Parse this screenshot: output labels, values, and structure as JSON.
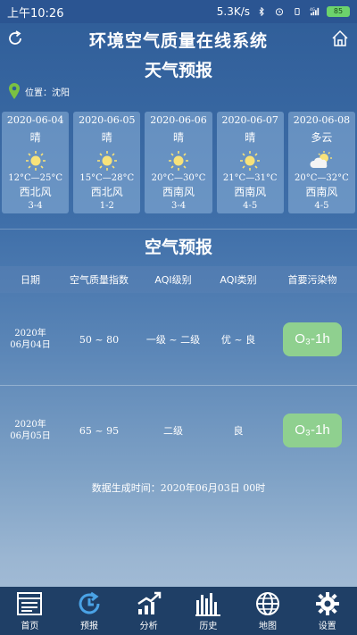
{
  "status_bar": {
    "time": "上午10:26",
    "net_speed": "5.3K/s",
    "signal_label": "4G",
    "battery": "85"
  },
  "header": {
    "title": "环境空气质量在线系统"
  },
  "weather": {
    "title": "天气预报",
    "location": "位置：沈阳",
    "days": [
      {
        "date": "2020-06-04",
        "condition": "晴",
        "icon": "sun-icon",
        "temp": "12°C—25°C",
        "wind": "西北风",
        "level": "3-4"
      },
      {
        "date": "2020-06-05",
        "condition": "晴",
        "icon": "sun-icon",
        "temp": "15°C—28°C",
        "wind": "西北风",
        "level": "1-2"
      },
      {
        "date": "2020-06-06",
        "condition": "晴",
        "icon": "sun-icon",
        "temp": "20°C—30°C",
        "wind": "西南风",
        "level": "3-4"
      },
      {
        "date": "2020-06-07",
        "condition": "晴",
        "icon": "sun-icon",
        "temp": "21°C—31°C",
        "wind": "西南风",
        "level": "4-5"
      },
      {
        "date": "2020-06-08",
        "condition": "多云",
        "icon": "cloudy-icon",
        "temp": "20°C—32°C",
        "wind": "西南风",
        "level": "4-5"
      }
    ]
  },
  "air": {
    "title": "空气预报",
    "columns": [
      "日期",
      "空气质量指数",
      "AQI级别",
      "AQI类别",
      "首要污染物"
    ],
    "rows": [
      {
        "date_line1": "2020年",
        "date_line2": "06月04日",
        "aqi": "50 ~ 80",
        "level": "一级 ~ 二级",
        "category": "优 ~ 良",
        "pollutant": "O₃-1h"
      },
      {
        "date_line1": "2020年",
        "date_line2": "06月05日",
        "aqi": "65 ~ 95",
        "level": "二级",
        "category": "良",
        "pollutant": "O₃-1h"
      }
    ],
    "generated": "数据生成时间：2020年06月03日 00时"
  },
  "nav": [
    {
      "label": "首页",
      "icon": "home-doc-icon"
    },
    {
      "label": "预报",
      "icon": "forecast-clock-icon"
    },
    {
      "label": "分析",
      "icon": "analysis-chart-icon"
    },
    {
      "label": "历史",
      "icon": "history-bars-icon"
    },
    {
      "label": "地图",
      "icon": "globe-icon"
    },
    {
      "label": "设置",
      "icon": "gear-icon"
    }
  ],
  "colors": {
    "pollutant_badge": "#8fd08f",
    "nav_active": "#4aa3e6",
    "location_pin": "#7bc142"
  }
}
